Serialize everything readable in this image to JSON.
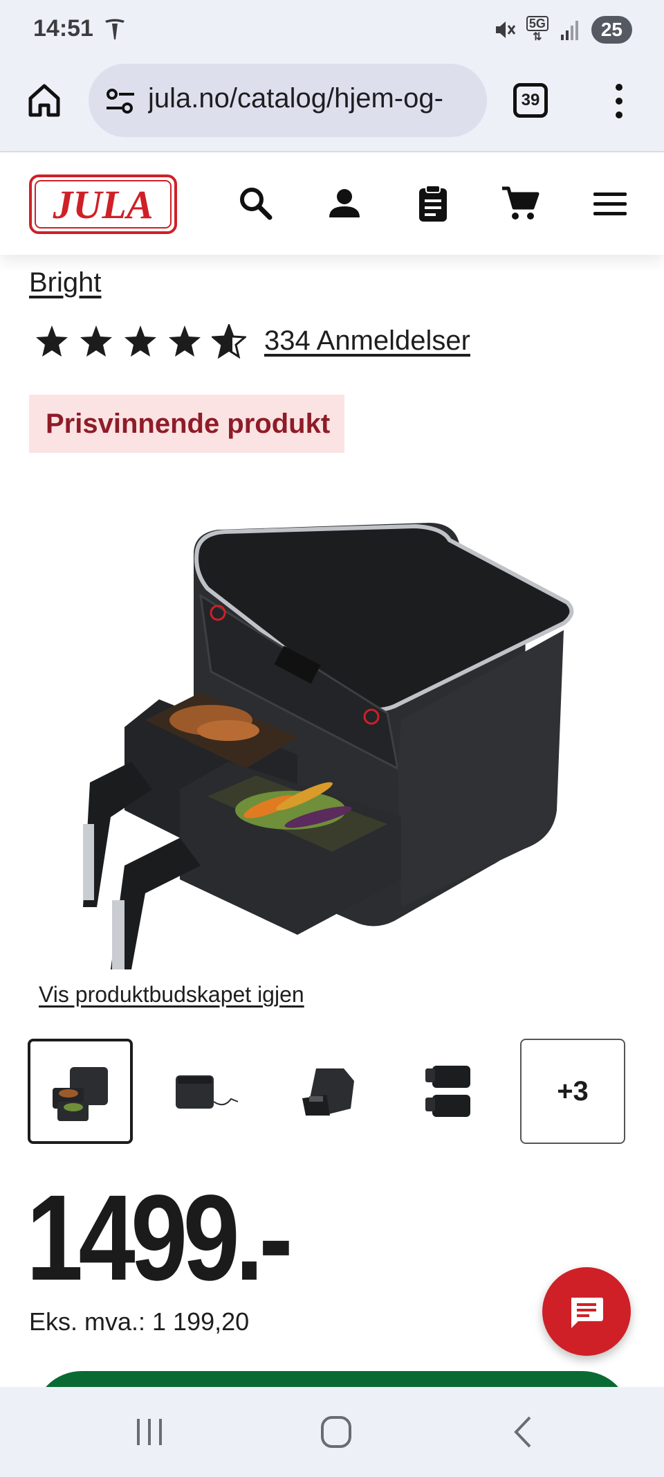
{
  "status_bar": {
    "time": "14:51",
    "network": "5G",
    "battery": "25",
    "icons": [
      "tesla-icon",
      "mute-icon",
      "5g-icon",
      "signal-icon",
      "battery-icon"
    ]
  },
  "browser": {
    "url": "jula.no/catalog/hjem-og-",
    "tab_count": "39",
    "icons": [
      "home-icon",
      "site-settings-icon",
      "tabs-icon",
      "more-vert-icon"
    ]
  },
  "site_header": {
    "logo_text": "JULA",
    "brand_color": "#cf2027",
    "icons": [
      "search-icon",
      "account-icon",
      "shopping-list-icon",
      "cart-icon",
      "hamburger-menu-icon"
    ]
  },
  "product": {
    "brand": "Bright",
    "rating": 4.5,
    "rating_max": 5,
    "reviews": "334 Anmeldelser",
    "badge": "Prisvinnende produkt",
    "show_message_link": "Vis produktbudskapet igjen",
    "more_images": "+3",
    "price": "1499.-",
    "vat_text": "Eks. mva.: 1 199,20",
    "cta_color": "#0a6a34"
  },
  "chat": {
    "icon": "chat-icon",
    "color": "#cf2027"
  },
  "nav_bar": {
    "icons": [
      "recents-icon",
      "home-circle-icon",
      "back-icon"
    ]
  }
}
